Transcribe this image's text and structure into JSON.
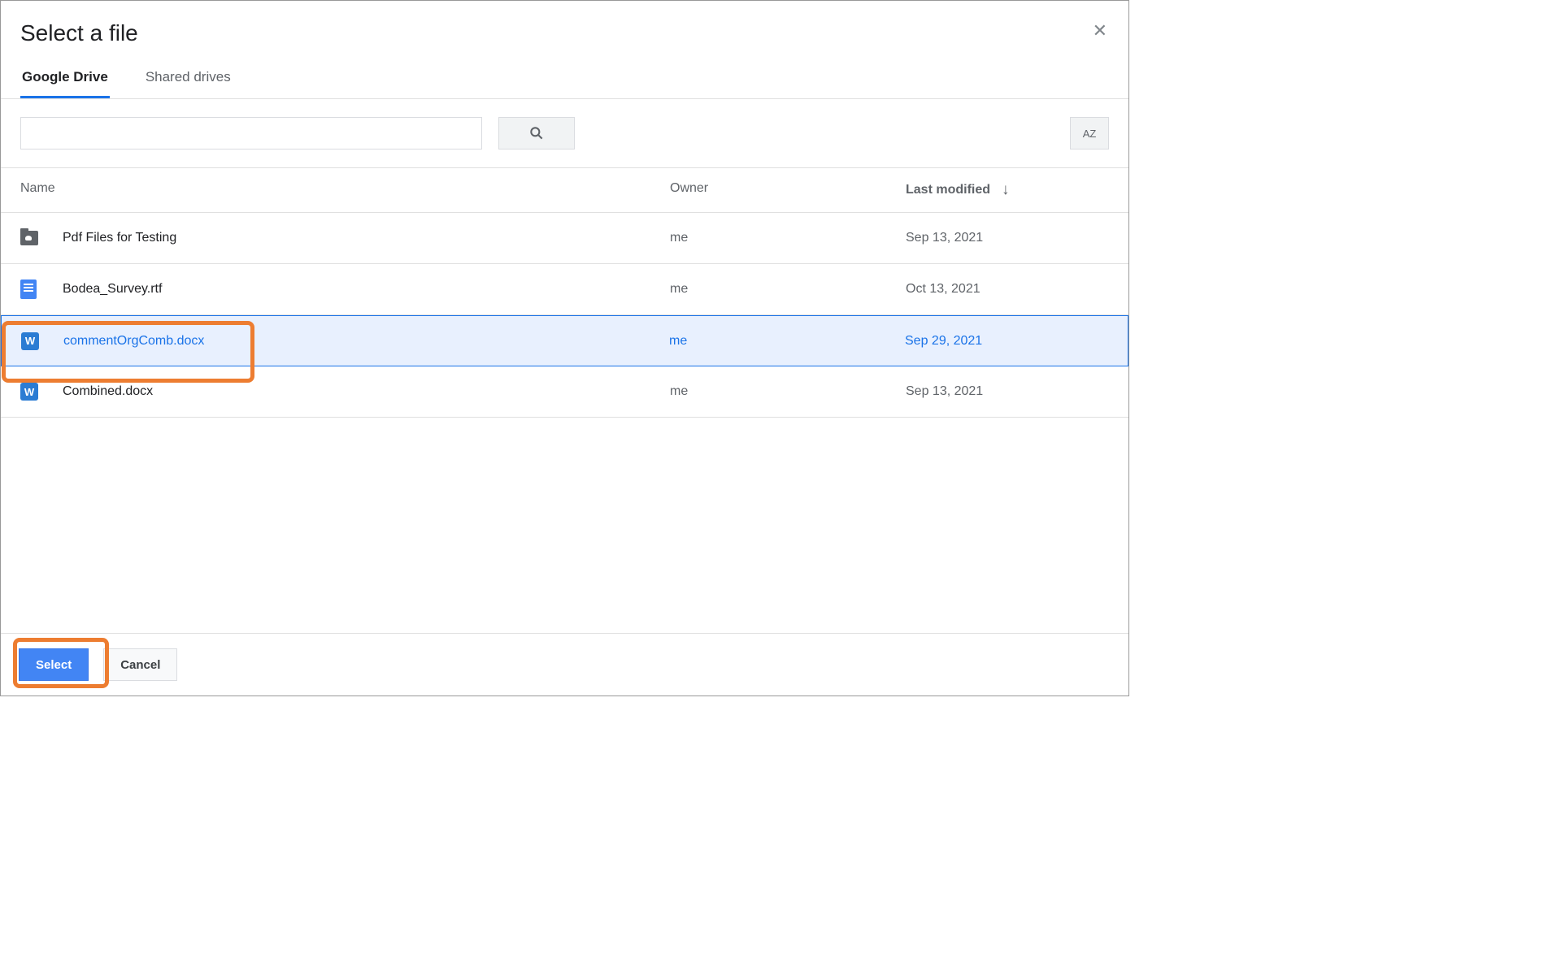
{
  "dialog": {
    "title": "Select a file"
  },
  "tabs": {
    "drive": "Google Drive",
    "shared": "Shared drives"
  },
  "columns": {
    "name": "Name",
    "owner": "Owner",
    "modified": "Last modified"
  },
  "files": [
    {
      "icon": "folder",
      "name": "Pdf Files for Testing",
      "owner": "me",
      "modified": "Sep 13, 2021",
      "selected": false
    },
    {
      "icon": "doc",
      "name": "Bodea_Survey.rtf",
      "owner": "me",
      "modified": "Oct 13, 2021",
      "selected": false
    },
    {
      "icon": "word",
      "name": "commentOrgComb.docx",
      "owner": "me",
      "modified": "Sep 29, 2021",
      "selected": true
    },
    {
      "icon": "word",
      "name": "Combined.docx",
      "owner": "me",
      "modified": "Sep 13, 2021",
      "selected": false
    }
  ],
  "buttons": {
    "select": "Select",
    "cancel": "Cancel"
  },
  "icons": {
    "word_letter": "W",
    "sort_label": "AZ"
  }
}
